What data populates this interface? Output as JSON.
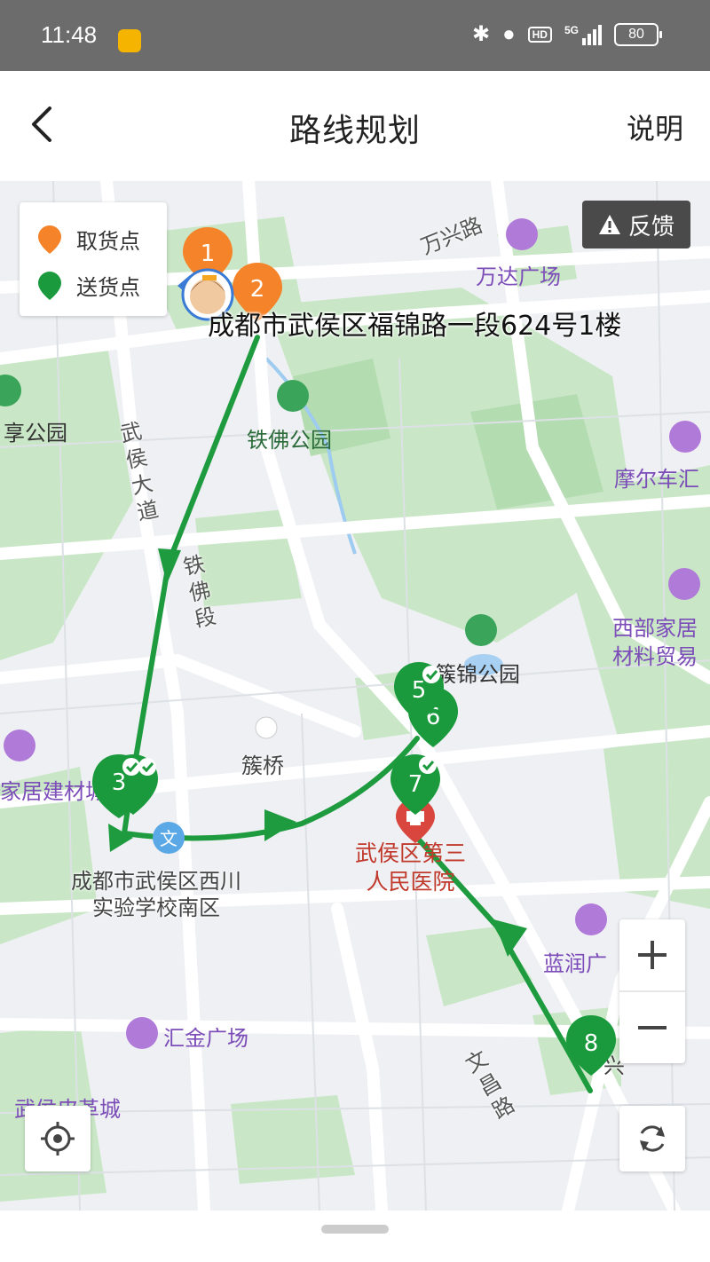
{
  "status_bar": {
    "time": "11:48",
    "network": "5G",
    "hd_label": "HD",
    "battery": "80"
  },
  "header": {
    "title": "路线规划",
    "help_label": "说明"
  },
  "legend": {
    "pickup_label": "取货点",
    "delivery_label": "送货点",
    "pickup_color": "#f5832a",
    "delivery_color": "#1a9a3c"
  },
  "feedback_label": "反馈",
  "current_address": "成都市武侯区福锦路一段624号1楼",
  "stops": [
    {
      "number": "1",
      "type": "pickup"
    },
    {
      "number": "2",
      "type": "pickup"
    },
    {
      "number": "3",
      "type": "delivery",
      "completed": true
    },
    {
      "number": "5",
      "type": "delivery",
      "completed": true
    },
    {
      "number": "6",
      "type": "delivery",
      "completed": false
    },
    {
      "number": "7",
      "type": "delivery",
      "completed": true
    },
    {
      "number": "8",
      "type": "delivery",
      "completed": false
    }
  ],
  "pois": {
    "wanda": "万达广场",
    "tiefo_park": "铁佛公园",
    "xiang_park": "享公园",
    "moto": "摩尔车汇",
    "xibu1": "西部家居",
    "xibu2": "材料贸易",
    "kuijin_park": "簇锦公园",
    "cuqiao": "簇桥",
    "jiaju": "家居建材城",
    "hospital_l1": "武侯区第三",
    "hospital_l2": "人民医院",
    "school_l1": "成都市武侯区西川",
    "school_l2": "实验学校南区",
    "lanrun": "蓝润广",
    "huijin": "汇金广场",
    "pige": "武侯皮革城",
    "xing": "兴"
  },
  "roads": {
    "wanxing": "万兴路",
    "wuhou": "武侯大道",
    "tiefo_seg": "铁佛段",
    "wenchang": "文昌路"
  },
  "colors": {
    "route": "#1e9b3e",
    "pickup": "#f5832a",
    "delivery": "#1a9a3c",
    "hospital": "#d9463e",
    "shop": "#b07ad8",
    "park": "#3aa55a"
  }
}
